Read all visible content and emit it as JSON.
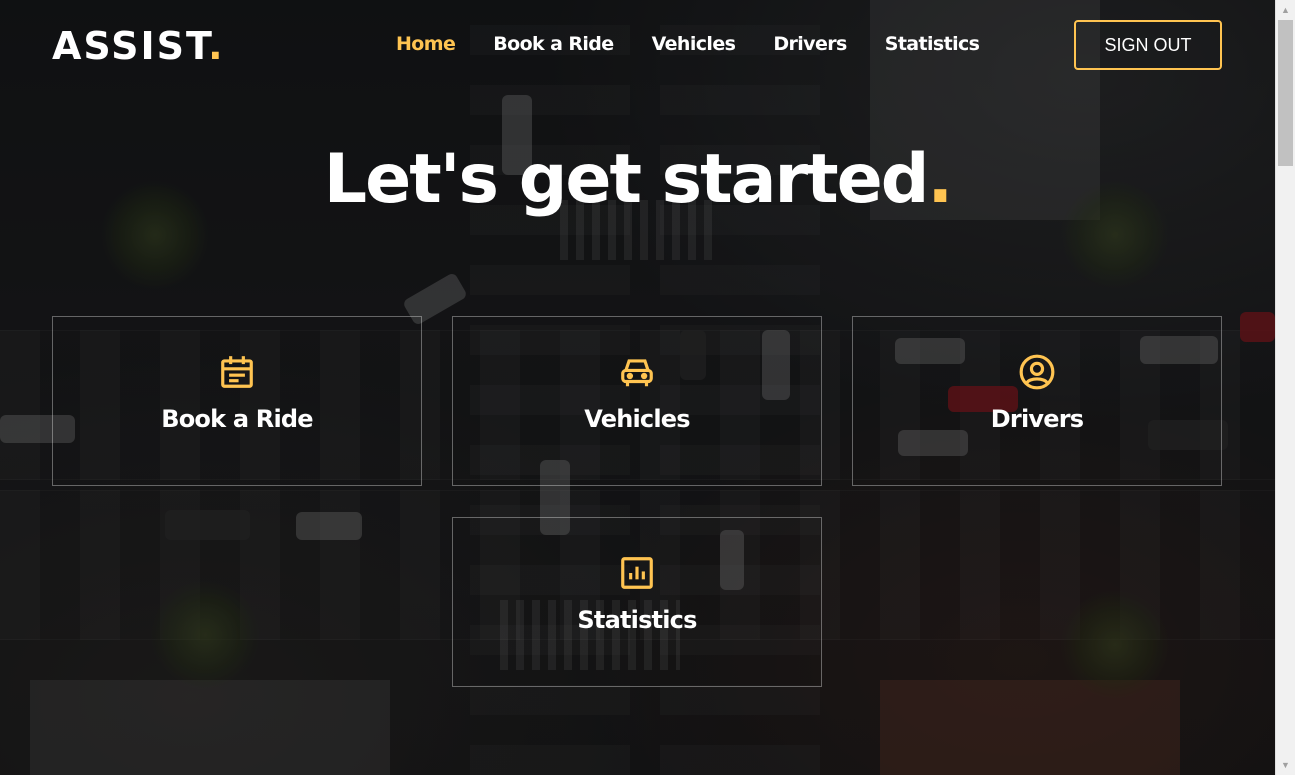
{
  "brand": {
    "name": "ASSIST",
    "dot": ".",
    "accent_color": "#ffc451"
  },
  "nav": {
    "items": [
      {
        "label": "Home",
        "active": true
      },
      {
        "label": "Book a Ride",
        "active": false
      },
      {
        "label": "Vehicles",
        "active": false
      },
      {
        "label": "Drivers",
        "active": false
      },
      {
        "label": "Statistics",
        "active": false
      }
    ]
  },
  "header": {
    "signout_label": "SIGN OUT"
  },
  "hero": {
    "title": "Let's get started",
    "dot": "."
  },
  "cards": [
    {
      "label": "Book a Ride",
      "icon": "calendar-icon"
    },
    {
      "label": "Vehicles",
      "icon": "car-icon"
    },
    {
      "label": "Drivers",
      "icon": "user-circle-icon"
    },
    {
      "label": "Statistics",
      "icon": "bar-chart-icon"
    }
  ]
}
